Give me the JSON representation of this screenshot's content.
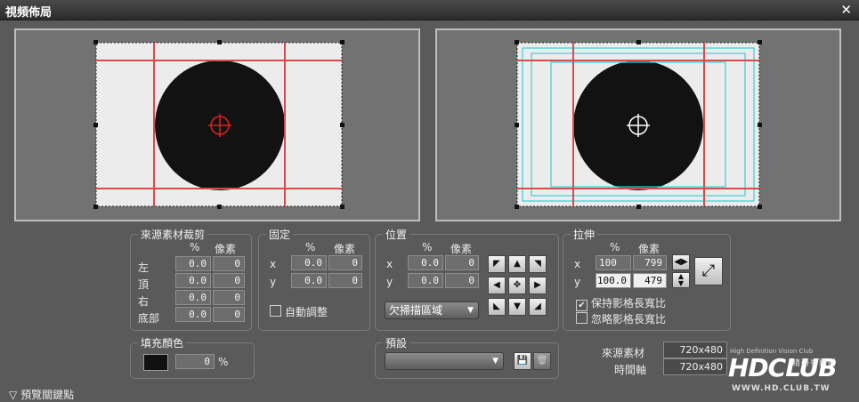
{
  "window": {
    "title": "視頻佈局",
    "close": "✕"
  },
  "crop": {
    "title": "來源素材裁剪",
    "col_pct": "%",
    "col_px": "像素",
    "rows": [
      {
        "label": "左",
        "pct": "0.0",
        "px": "0"
      },
      {
        "label": "頂",
        "pct": "0.0",
        "px": "0"
      },
      {
        "label": "右",
        "pct": "0.0",
        "px": "0"
      },
      {
        "label": "底部",
        "pct": "0.0",
        "px": "0"
      }
    ]
  },
  "fixed": {
    "title": "固定",
    "col_pct": "%",
    "col_px": "像素",
    "rows": [
      {
        "label": "x",
        "pct": "0.0",
        "px": "0"
      },
      {
        "label": "y",
        "pct": "0.0",
        "px": "0"
      }
    ],
    "auto_adjust": "自動調整"
  },
  "position": {
    "title": "位置",
    "col_pct": "%",
    "col_px": "像素",
    "rows": [
      {
        "label": "x",
        "pct": "0.0",
        "px": "0"
      },
      {
        "label": "y",
        "pct": "0.0",
        "px": "0"
      }
    ],
    "scan_option": "欠掃描區域"
  },
  "stretch": {
    "title": "拉伸",
    "col_pct": "%",
    "col_px": "像素",
    "rows": [
      {
        "label": "x",
        "pct": "100",
        "px": "799"
      },
      {
        "label": "y",
        "pct": "100.0",
        "px": "479"
      }
    ],
    "keep_aspect": "保持影格長寬比",
    "ignore_aspect": "忽略影格長寬比"
  },
  "fill": {
    "title": "填充顏色",
    "opacity": "0",
    "unit": "%",
    "color": "#111111"
  },
  "preset": {
    "title": "預設",
    "selected": ""
  },
  "source_info": {
    "source_label": "來源素材",
    "source_value": "720x480",
    "timeline_label": "時間軸",
    "timeline_value": "720x480"
  },
  "keypoint": {
    "label": "預覽關鍵點"
  },
  "watermark": {
    "brand": "HDCLUB",
    "sub_cn": "精研事務所",
    "url": "WWW.HD.CLUB.TW",
    "tagline": "High Definition Vision Club"
  }
}
